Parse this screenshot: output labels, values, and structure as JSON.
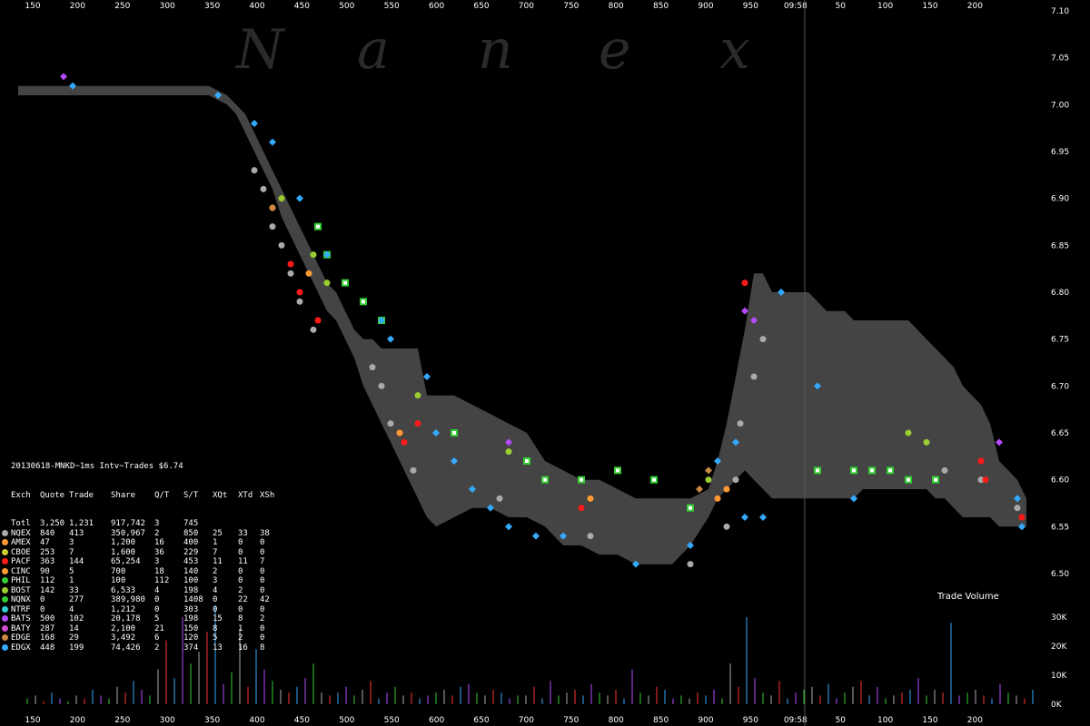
{
  "watermark": [
    "N",
    "a",
    "n",
    "e",
    "x"
  ],
  "chart_data": {
    "type": "scatter",
    "title": "20130618-MNKD~1ms Intv~Trades $6.74",
    "ylim": [
      6.48,
      7.1
    ],
    "y_ticks": [
      7.1,
      7.05,
      7.0,
      6.95,
      6.9,
      6.85,
      6.8,
      6.75,
      6.7,
      6.65,
      6.6,
      6.55,
      6.5
    ],
    "x_ticks": [
      "150",
      "200",
      "250",
      "300",
      "350",
      "400",
      "450",
      "500",
      "550",
      "600",
      "650",
      "700",
      "750",
      "800",
      "850",
      "900",
      "950",
      "09:58",
      "50",
      "100",
      "150",
      "200"
    ],
    "volume_ticks": [
      "30K",
      "20K",
      "10K",
      "0K"
    ],
    "volume_label": "Trade Volume",
    "grid": false,
    "nbbo_band": {
      "x": [
        20,
        80,
        150,
        230,
        250,
        260,
        270,
        280,
        290,
        300,
        310,
        320,
        330,
        340,
        350,
        360,
        370,
        380,
        390,
        400,
        410,
        420,
        430,
        440,
        450,
        460,
        470,
        480,
        500,
        520,
        540,
        560,
        580,
        600,
        620,
        640,
        660,
        680,
        700,
        720,
        740,
        760,
        780,
        790,
        800,
        810,
        820,
        830,
        840,
        850,
        860,
        870,
        880,
        890,
        900,
        910,
        920,
        930,
        940,
        950,
        960,
        970,
        980,
        990,
        1000,
        1010,
        1020,
        1030,
        1040,
        1050,
        1060,
        1070,
        1080,
        1090,
        1100,
        1110,
        1120,
        1130
      ],
      "high": [
        7.02,
        7.02,
        7.02,
        7.02,
        7.01,
        7.0,
        6.99,
        6.97,
        6.95,
        6.93,
        6.91,
        6.89,
        6.87,
        6.85,
        6.83,
        6.81,
        6.8,
        6.78,
        6.76,
        6.75,
        6.75,
        6.74,
        6.74,
        6.74,
        6.74,
        6.74,
        6.69,
        6.69,
        6.69,
        6.68,
        6.67,
        6.66,
        6.65,
        6.62,
        6.61,
        6.6,
        6.6,
        6.59,
        6.58,
        6.58,
        6.58,
        6.58,
        6.59,
        6.62,
        6.66,
        6.71,
        6.76,
        6.82,
        6.82,
        6.8,
        6.8,
        6.8,
        6.8,
        6.8,
        6.79,
        6.78,
        6.78,
        6.78,
        6.77,
        6.77,
        6.77,
        6.77,
        6.77,
        6.77,
        6.77,
        6.76,
        6.75,
        6.74,
        6.73,
        6.72,
        6.7,
        6.69,
        6.68,
        6.66,
        6.62,
        6.61,
        6.6,
        6.58
      ],
      "low": [
        7.01,
        7.01,
        7.01,
        7.01,
        7.0,
        6.99,
        6.97,
        6.95,
        6.93,
        6.91,
        6.88,
        6.86,
        6.84,
        6.82,
        6.8,
        6.78,
        6.77,
        6.75,
        6.73,
        6.7,
        6.68,
        6.66,
        6.64,
        6.62,
        6.6,
        6.58,
        6.56,
        6.55,
        6.56,
        6.57,
        6.57,
        6.56,
        6.56,
        6.55,
        6.53,
        6.53,
        6.52,
        6.52,
        6.51,
        6.51,
        6.51,
        6.53,
        6.56,
        6.58,
        6.59,
        6.6,
        6.61,
        6.6,
        6.59,
        6.58,
        6.58,
        6.58,
        6.58,
        6.58,
        6.58,
        6.58,
        6.58,
        6.58,
        6.58,
        6.59,
        6.59,
        6.59,
        6.59,
        6.59,
        6.59,
        6.59,
        6.59,
        6.58,
        6.58,
        6.57,
        6.56,
        6.56,
        6.56,
        6.56,
        6.55,
        6.55,
        6.55,
        6.55
      ]
    },
    "series": [
      {
        "name": "NQEX",
        "color": "#aaaaaa",
        "points": [
          [
            280,
            6.93
          ],
          [
            290,
            6.91
          ],
          [
            300,
            6.87
          ],
          [
            310,
            6.85
          ],
          [
            320,
            6.82
          ],
          [
            330,
            6.79
          ],
          [
            345,
            6.76
          ],
          [
            410,
            6.72
          ],
          [
            420,
            6.7
          ],
          [
            430,
            6.66
          ],
          [
            455,
            6.61
          ],
          [
            550,
            6.58
          ],
          [
            650,
            6.54
          ],
          [
            760,
            6.51
          ],
          [
            800,
            6.55
          ],
          [
            810,
            6.6
          ],
          [
            815,
            6.66
          ],
          [
            830,
            6.71
          ],
          [
            840,
            6.75
          ],
          [
            1040,
            6.61
          ],
          [
            1080,
            6.6
          ],
          [
            1120,
            6.57
          ]
        ]
      },
      {
        "name": "PACF",
        "color": "#ff1a1a",
        "points": [
          [
            320,
            6.83
          ],
          [
            330,
            6.8
          ],
          [
            350,
            6.77
          ],
          [
            440,
            6.65
          ],
          [
            445,
            6.64
          ],
          [
            460,
            6.66
          ],
          [
            640,
            6.57
          ],
          [
            820,
            6.81
          ],
          [
            1080,
            6.62
          ],
          [
            1085,
            6.6
          ],
          [
            1125,
            6.56
          ]
        ]
      },
      {
        "name": "CINC",
        "color": "#ff9933",
        "points": [
          [
            300,
            6.89
          ],
          [
            340,
            6.82
          ],
          [
            440,
            6.65
          ],
          [
            650,
            6.58
          ],
          [
            790,
            6.58
          ],
          [
            800,
            6.59
          ]
        ]
      },
      {
        "name": "BOST",
        "color": "#9acd32",
        "points": [
          [
            310,
            6.9
          ],
          [
            345,
            6.84
          ],
          [
            360,
            6.81
          ],
          [
            460,
            6.69
          ],
          [
            560,
            6.63
          ],
          [
            780,
            6.6
          ],
          [
            1000,
            6.65
          ],
          [
            1020,
            6.64
          ]
        ]
      },
      {
        "name": "NQNX",
        "color": "#33cc33",
        "points": [
          [
            350,
            6.87
          ],
          [
            360,
            6.84
          ],
          [
            380,
            6.81
          ],
          [
            400,
            6.79
          ],
          [
            420,
            6.77
          ],
          [
            500,
            6.65
          ],
          [
            580,
            6.62
          ],
          [
            600,
            6.6
          ],
          [
            640,
            6.6
          ],
          [
            680,
            6.61
          ],
          [
            720,
            6.6
          ],
          [
            760,
            6.57
          ],
          [
            900,
            6.61
          ],
          [
            940,
            6.61
          ],
          [
            960,
            6.61
          ],
          [
            980,
            6.61
          ],
          [
            1000,
            6.6
          ],
          [
            1030,
            6.6
          ]
        ]
      },
      {
        "name": "BATS",
        "color": "#b44bff",
        "points": [
          [
            70,
            7.03
          ],
          [
            560,
            6.64
          ],
          [
            820,
            6.78
          ],
          [
            830,
            6.77
          ],
          [
            1100,
            6.64
          ]
        ]
      },
      {
        "name": "EDGE",
        "color": "#cc8844",
        "points": [
          [
            300,
            6.89
          ],
          [
            770,
            6.59
          ],
          [
            780,
            6.61
          ]
        ]
      },
      {
        "name": "EDGX",
        "color": "#33aaff",
        "points": [
          [
            80,
            7.02
          ],
          [
            240,
            7.01
          ],
          [
            280,
            6.98
          ],
          [
            300,
            6.96
          ],
          [
            330,
            6.9
          ],
          [
            360,
            6.84
          ],
          [
            420,
            6.77
          ],
          [
            430,
            6.75
          ],
          [
            470,
            6.71
          ],
          [
            480,
            6.65
          ],
          [
            500,
            6.62
          ],
          [
            520,
            6.59
          ],
          [
            540,
            6.57
          ],
          [
            560,
            6.55
          ],
          [
            590,
            6.54
          ],
          [
            620,
            6.54
          ],
          [
            700,
            6.51
          ],
          [
            760,
            6.53
          ],
          [
            790,
            6.62
          ],
          [
            810,
            6.64
          ],
          [
            820,
            6.56
          ],
          [
            840,
            6.56
          ],
          [
            860,
            6.8
          ],
          [
            900,
            6.7
          ],
          [
            940,
            6.58
          ],
          [
            1120,
            6.58
          ],
          [
            1125,
            6.55
          ]
        ]
      }
    ],
    "volume": [
      2,
      3,
      1,
      4,
      2,
      1,
      3,
      2,
      5,
      3,
      2,
      6,
      4,
      8,
      5,
      3,
      12,
      22,
      9,
      30,
      14,
      18,
      25,
      34,
      7,
      11,
      26,
      6,
      19,
      12,
      8,
      5,
      4,
      6,
      9,
      14,
      4,
      3,
      4,
      6,
      3,
      5,
      8,
      2,
      4,
      6,
      3,
      4,
      2,
      3,
      4,
      5,
      3,
      6,
      7,
      4,
      3,
      5,
      4,
      2,
      3,
      3,
      6,
      2,
      8,
      3,
      4,
      5,
      3,
      7,
      4,
      3,
      5,
      2,
      12,
      4,
      3,
      6,
      5,
      2,
      3,
      2,
      4,
      3,
      5,
      2,
      14,
      6,
      30,
      9,
      4,
      3,
      8,
      2,
      4,
      5,
      6,
      3,
      7,
      2,
      4,
      6,
      8,
      3,
      6,
      2,
      3,
      4,
      5,
      9,
      3,
      5,
      4,
      28,
      3,
      4,
      5,
      3,
      2,
      7,
      4,
      3,
      2,
      5,
      20,
      4,
      3
    ]
  },
  "stats": {
    "headers": [
      "Exch",
      "Quote",
      "Trade",
      "Share",
      "Q/T",
      "S/T",
      "XQt",
      "XTd",
      "XSh"
    ],
    "rows": [
      {
        "ex": "Totl",
        "q": "3,250",
        "t": "1,231",
        "s": "917,742",
        "qt": "3",
        "st": "745",
        "xq": "",
        "xt": "",
        "xs": "",
        "color": ""
      },
      {
        "ex": "NQEX",
        "q": "840",
        "t": "413",
        "s": "350,967",
        "qt": "2",
        "st": "850",
        "xq": "25",
        "xt": "33",
        "xs": "38",
        "color": "#aaaaaa"
      },
      {
        "ex": "AMEX",
        "q": "47",
        "t": "3",
        "s": "1,200",
        "qt": "16",
        "st": "400",
        "xq": "1",
        "xt": "0",
        "xs": "0",
        "color": "#ff9933"
      },
      {
        "ex": "CBOE",
        "q": "253",
        "t": "7",
        "s": "1,600",
        "qt": "36",
        "st": "229",
        "xq": "7",
        "xt": "0",
        "xs": "0",
        "color": "#cccc33"
      },
      {
        "ex": "PACF",
        "q": "363",
        "t": "144",
        "s": "65,254",
        "qt": "3",
        "st": "453",
        "xq": "11",
        "xt": "11",
        "xs": "7",
        "color": "#ff1a1a"
      },
      {
        "ex": "CINC",
        "q": "90",
        "t": "5",
        "s": "700",
        "qt": "18",
        "st": "140",
        "xq": "2",
        "xt": "0",
        "xs": "0",
        "color": "#ff9933"
      },
      {
        "ex": "PHIL",
        "q": "112",
        "t": "1",
        "s": "100",
        "qt": "112",
        "st": "100",
        "xq": "3",
        "xt": "0",
        "xs": "0",
        "color": "#33cc33"
      },
      {
        "ex": "BOST",
        "q": "142",
        "t": "33",
        "s": "6,533",
        "qt": "4",
        "st": "198",
        "xq": "4",
        "xt": "2",
        "xs": "0",
        "color": "#9acd32"
      },
      {
        "ex": "NQNX",
        "q": "0",
        "t": "277",
        "s": "389,980",
        "qt": "0",
        "st": "1408",
        "xq": "0",
        "xt": "22",
        "xs": "42",
        "color": "#33cc33"
      },
      {
        "ex": "NTRF",
        "q": "0",
        "t": "4",
        "s": "1,212",
        "qt": "0",
        "st": "303",
        "xq": "0",
        "xt": "0",
        "xs": "0",
        "color": "#33cccc"
      },
      {
        "ex": "BATS",
        "q": "500",
        "t": "102",
        "s": "20,178",
        "qt": "5",
        "st": "198",
        "xq": "15",
        "xt": "8",
        "xs": "2",
        "color": "#b44bff"
      },
      {
        "ex": "BATY",
        "q": "287",
        "t": "14",
        "s": "2,100",
        "qt": "21",
        "st": "150",
        "xq": "8",
        "xt": "1",
        "xs": "0",
        "color": "#d04bd0"
      },
      {
        "ex": "EDGE",
        "q": "168",
        "t": "29",
        "s": "3,492",
        "qt": "6",
        "st": "120",
        "xq": "5",
        "xt": "2",
        "xs": "0",
        "color": "#cc8844"
      },
      {
        "ex": "EDGX",
        "q": "448",
        "t": "199",
        "s": "74,426",
        "qt": "2",
        "st": "374",
        "xq": "13",
        "xt": "16",
        "xs": "8",
        "color": "#33aaff"
      }
    ]
  }
}
